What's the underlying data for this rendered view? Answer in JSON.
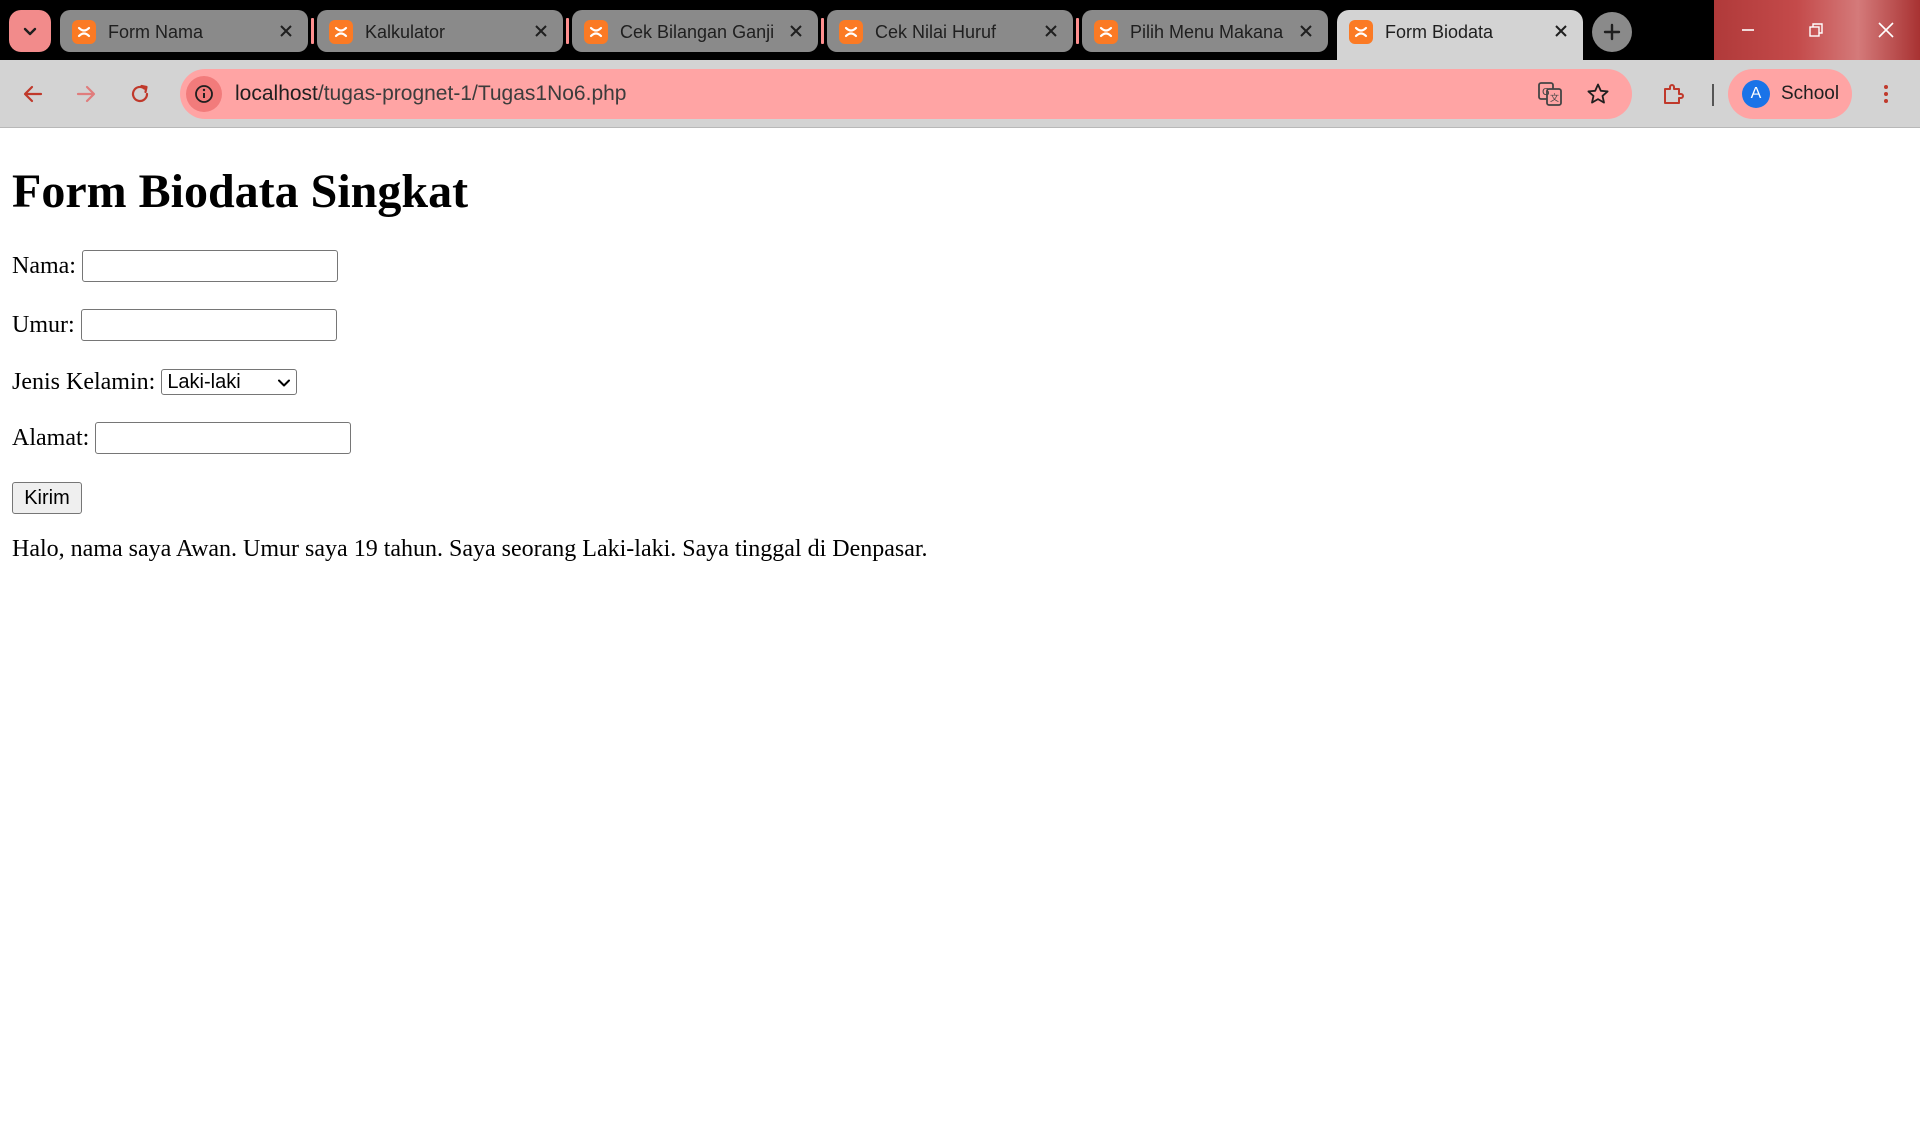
{
  "browser": {
    "tabs": [
      {
        "title": "Form Nama",
        "active": false
      },
      {
        "title": "Kalkulator",
        "active": false
      },
      {
        "title": "Cek Bilangan Ganjil",
        "active": false
      },
      {
        "title": "Cek Nilai Huruf",
        "active": false
      },
      {
        "title": "Pilih Menu Makanan",
        "active": false
      },
      {
        "title": "Form Biodata",
        "active": true
      }
    ],
    "address": {
      "host": "localhost",
      "path": "/tugas-prognet-1/Tugas1No6.php"
    },
    "profile": {
      "initial": "A",
      "name": "School"
    },
    "colors": {
      "tab_sep": "#ff8f8f",
      "omnibox": "#ffa4a4",
      "favicon": "#fb7a24",
      "avatar": "#1a73e8"
    }
  },
  "page": {
    "heading": "Form Biodata Singkat",
    "form": {
      "nama_label": "Nama:",
      "nama_value": "",
      "umur_label": "Umur:",
      "umur_value": "",
      "gender_label": "Jenis Kelamin:",
      "gender_selected": "Laki-laki",
      "alamat_label": "Alamat:",
      "alamat_value": "",
      "submit_label": "Kirim"
    },
    "output": "Halo, nama saya Awan. Umur saya 19 tahun. Saya seorang Laki-laki. Saya tinggal di Denpasar."
  }
}
